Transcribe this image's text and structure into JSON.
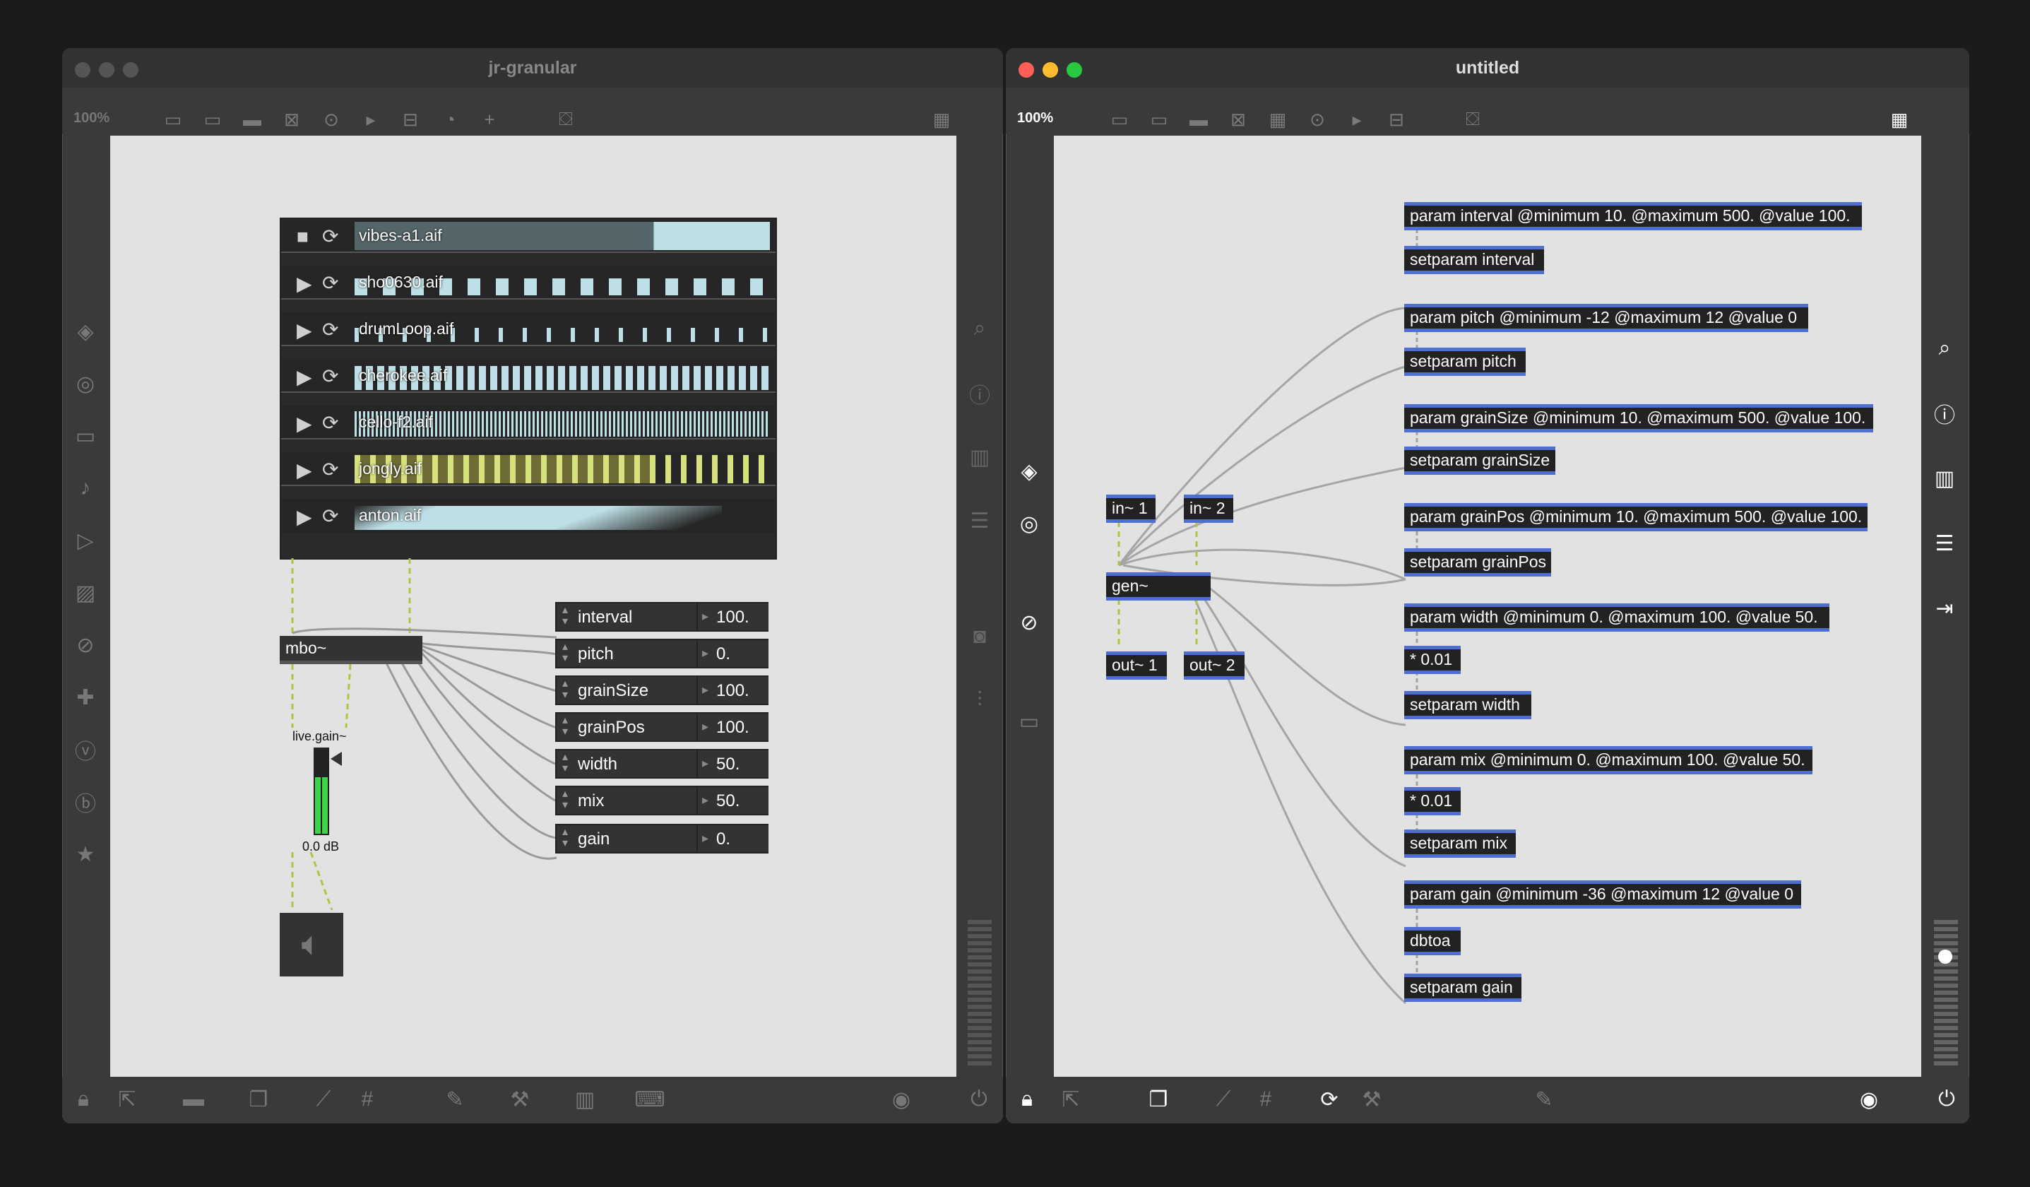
{
  "left_window": {
    "title": "jr-granular",
    "zoom": "100%",
    "playlist": [
      {
        "name": "vibes-a1.aif",
        "state": "stop"
      },
      {
        "name": "sho0630.aif",
        "state": "play"
      },
      {
        "name": "drumLoop.aif",
        "state": "play"
      },
      {
        "name": "cherokee.aif",
        "state": "play"
      },
      {
        "name": "cello-f2.aif",
        "state": "play"
      },
      {
        "name": "jongly.aif",
        "state": "play"
      },
      {
        "name": "anton.aif",
        "state": "play"
      }
    ],
    "mbo_label": "mbo~",
    "gain_label": "live.gain~",
    "gain_value": "0.0 dB",
    "attrs": [
      {
        "name": "interval",
        "value": "100."
      },
      {
        "name": "pitch",
        "value": "0."
      },
      {
        "name": "grainSize",
        "value": "100."
      },
      {
        "name": "grainPos",
        "value": "100."
      },
      {
        "name": "width",
        "value": "50."
      },
      {
        "name": "mix",
        "value": "50."
      },
      {
        "name": "gain",
        "value": "0."
      }
    ]
  },
  "right_window": {
    "title": "untitled",
    "zoom": "100%",
    "objects": {
      "in1": "in~ 1",
      "in2": "in~ 2",
      "gen": "gen~",
      "out1": "out~ 1",
      "out2": "out~ 2",
      "p_interval": "param interval @minimum 10. @maximum 500. @value 100.",
      "s_interval": "setparam interval",
      "p_pitch": "param pitch @minimum -12 @maximum 12 @value 0",
      "s_pitch": "setparam pitch",
      "p_grainSize": "param grainSize @minimum 10. @maximum 500. @value 100.",
      "s_grainSize": "setparam grainSize",
      "p_grainPos": "param grainPos @minimum 10. @maximum 500. @value 100.",
      "s_grainPos": "setparam grainPos",
      "p_width": "param width @minimum 0. @maximum 100. @value 50.",
      "m_width": "* 0.01",
      "s_width": "setparam width",
      "p_mix": "param mix @minimum 0. @maximum 100. @value 50.",
      "m_mix": "* 0.01",
      "s_mix": "setparam mix",
      "p_gain": "param gain @minimum -36 @maximum 12 @value 0",
      "dbtoa": "dbtoa",
      "s_gain": "setparam gain"
    }
  },
  "colors": {
    "accent_blue": "#4f6fd0",
    "waveform": "#bde0e6",
    "selection": "#d7e07f",
    "meter_green": "#3fd24a"
  }
}
